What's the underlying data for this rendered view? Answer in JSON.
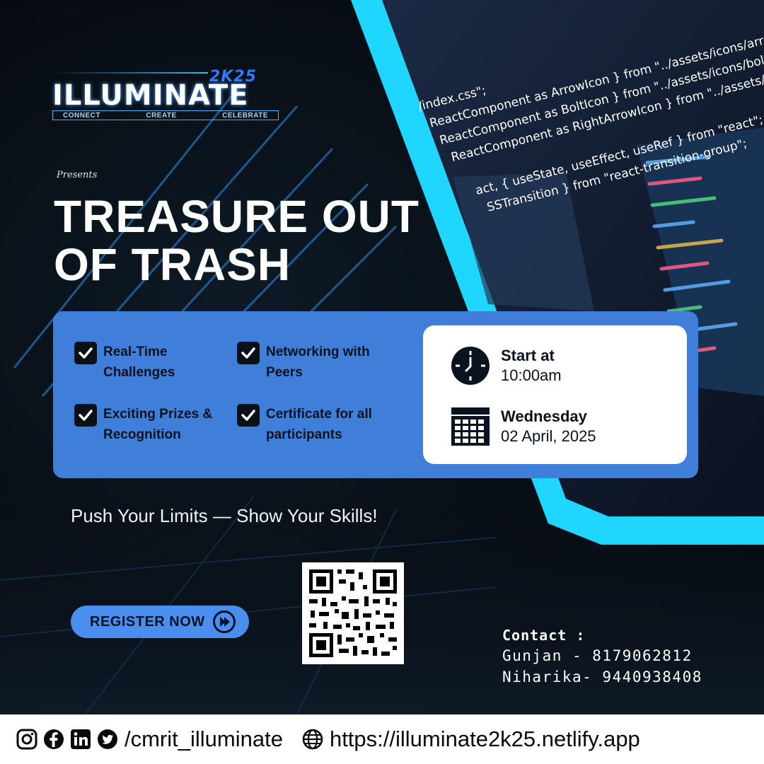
{
  "logo": {
    "year": "2K25",
    "name": "ILLUMINATE",
    "tagline": [
      "CONNECT",
      "CREATE",
      "CELEBRATE"
    ]
  },
  "presents": "Presents",
  "title": {
    "line1": "TREASURE OUT",
    "line2": "OF TRASH"
  },
  "features": [
    {
      "line1": "Real-Time",
      "line2": "Challenges"
    },
    {
      "line1": "Networking with",
      "line2": "Peers"
    },
    {
      "line1": "Exciting Prizes &",
      "line2": "Recognition"
    },
    {
      "line1": "Certificate for all",
      "line2": "participants"
    }
  ],
  "schedule": {
    "time_label": "Start at",
    "time_value": "10:00am",
    "day_label": "Wednesday",
    "date_value": "02 April, 2025"
  },
  "tagline": "Push Your Limits — Show Your Skills!",
  "register_label": "REGISTER NOW",
  "contact": {
    "title": "Contact :",
    "line1": "Gunjan - 8179062812",
    "line2": "Niharika- 9440938408"
  },
  "footer": {
    "icons": [
      "instagram-icon",
      "facebook-icon",
      "linkedin-icon",
      "twitter-icon",
      "globe-icon"
    ],
    "handle": "/cmrit_illuminate",
    "url": "https://illuminate2k25.netlify.app"
  },
  "code_snippets": [
    "/index.css\";",
    "ReactComponent as ArrowIcon } from \"../assets/icons/arrow.svg\";",
    "ReactComponent as BoltIcon } from \"../assets/icons/bolt.svg\";",
    "ReactComponent as RightArrowIcon } from \"../assets/icons/right-arrow.svg\";",
    "act, { useState, useEffect, useRef } from \"react\";",
    "SSTransition } from \"react-transition-group\";"
  ],
  "colors": {
    "accent_cyan": "#1fd6ff",
    "panel_blue": "#3f7fd9",
    "button_blue": "#4a8ff0",
    "dark": "#0b1220"
  }
}
